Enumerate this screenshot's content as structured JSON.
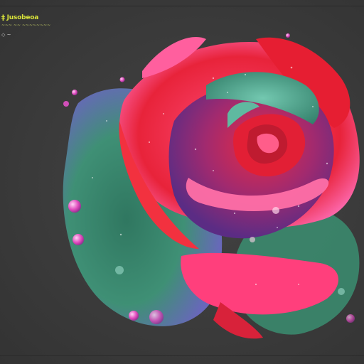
{
  "overlay": {
    "title": "ǂ Jusobeoa",
    "subtitle": "~~~ ~~ ~~~~~~~~",
    "icons": "◇ ~"
  },
  "image": {
    "subject": "rose-with-water-droplets",
    "colors": {
      "background": "#3b3b3b",
      "petal_red": "#e8233a",
      "petal_pink": "#ff5fb0",
      "leaf_green": "#3e8f72",
      "core_purple": "#6a3f8c",
      "teal": "#5fb9a0"
    }
  }
}
